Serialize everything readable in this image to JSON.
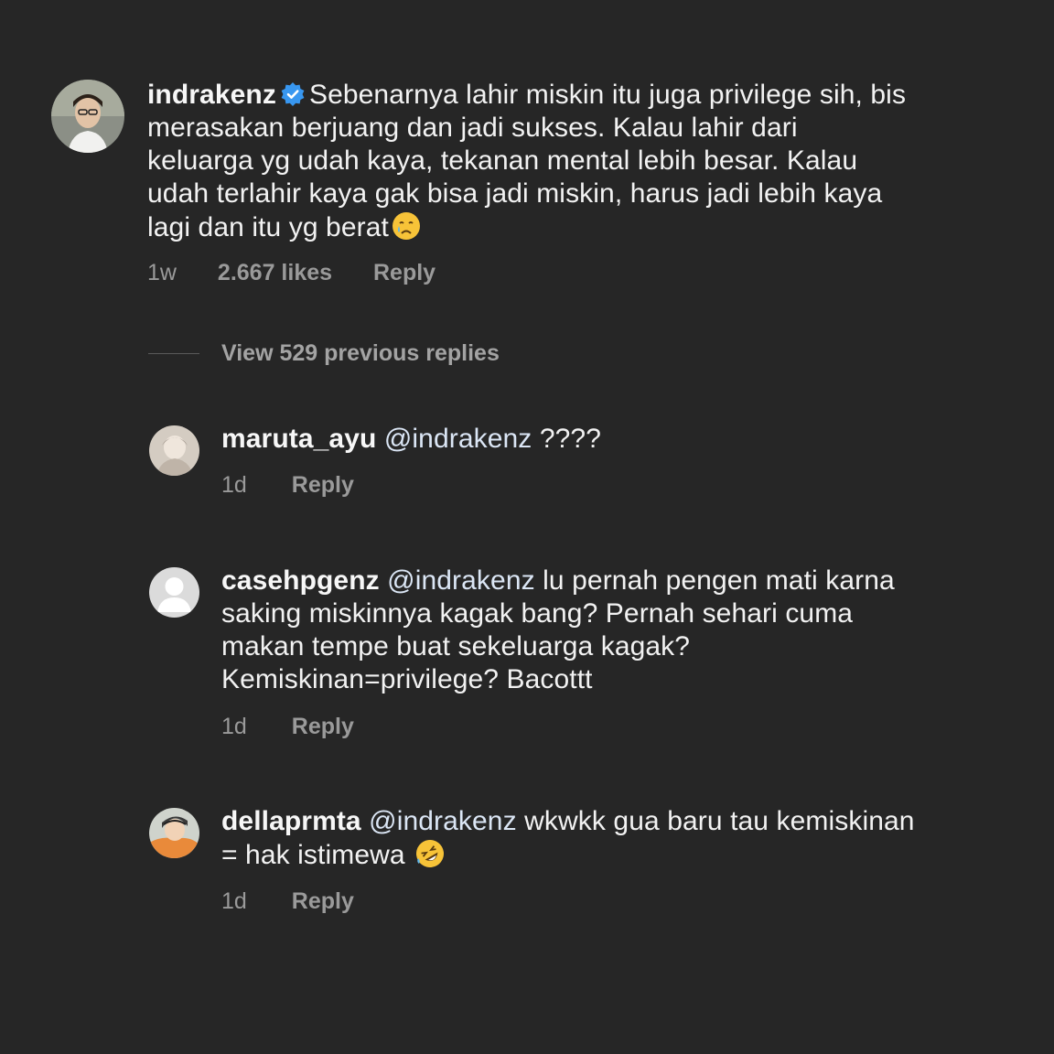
{
  "main_comment": {
    "username": "indrakenz",
    "verified_icon": "verified-badge-icon",
    "text": "Sebenarnya lahir miskin itu juga privilege sih, bis merasakan berjuang dan jadi sukses. Kalau lahir dari keluarga yg udah kaya, tekanan mental lebih besar. Kalau udah terlahir kaya gak bisa jadi miskin, harus jadi lebih kaya lagi dan itu yg berat",
    "emoji": "crying-face-emoji",
    "time": "1w",
    "likes": "2.667 likes",
    "reply_label": "Reply"
  },
  "view_replies_label": "View 529 previous replies",
  "replies": [
    {
      "username": "maruta_ayu",
      "mention": "@indrakenz",
      "text": " ????",
      "time": "1d",
      "reply_label": "Reply"
    },
    {
      "username": "casehpgenz",
      "mention": "@indrakenz",
      "text": " lu pernah pengen mati karna saking miskinnya kagak bang? Pernah sehari cuma makan tempe buat sekeluarga kagak? Kemiskinan=privilege? Bacottt",
      "time": "1d",
      "reply_label": "Reply"
    },
    {
      "username": "dellaprmta",
      "mention": "@indrakenz",
      "text": " wkwkk gua baru tau kemiskinan = hak istimewa ",
      "emoji": "rolling-on-floor-laughing-emoji",
      "time": "1d",
      "reply_label": "Reply"
    }
  ],
  "colors": {
    "background": "#262626",
    "text": "#f2f2f2",
    "meta": "#9a9a9a",
    "verified": "#3897f0"
  }
}
